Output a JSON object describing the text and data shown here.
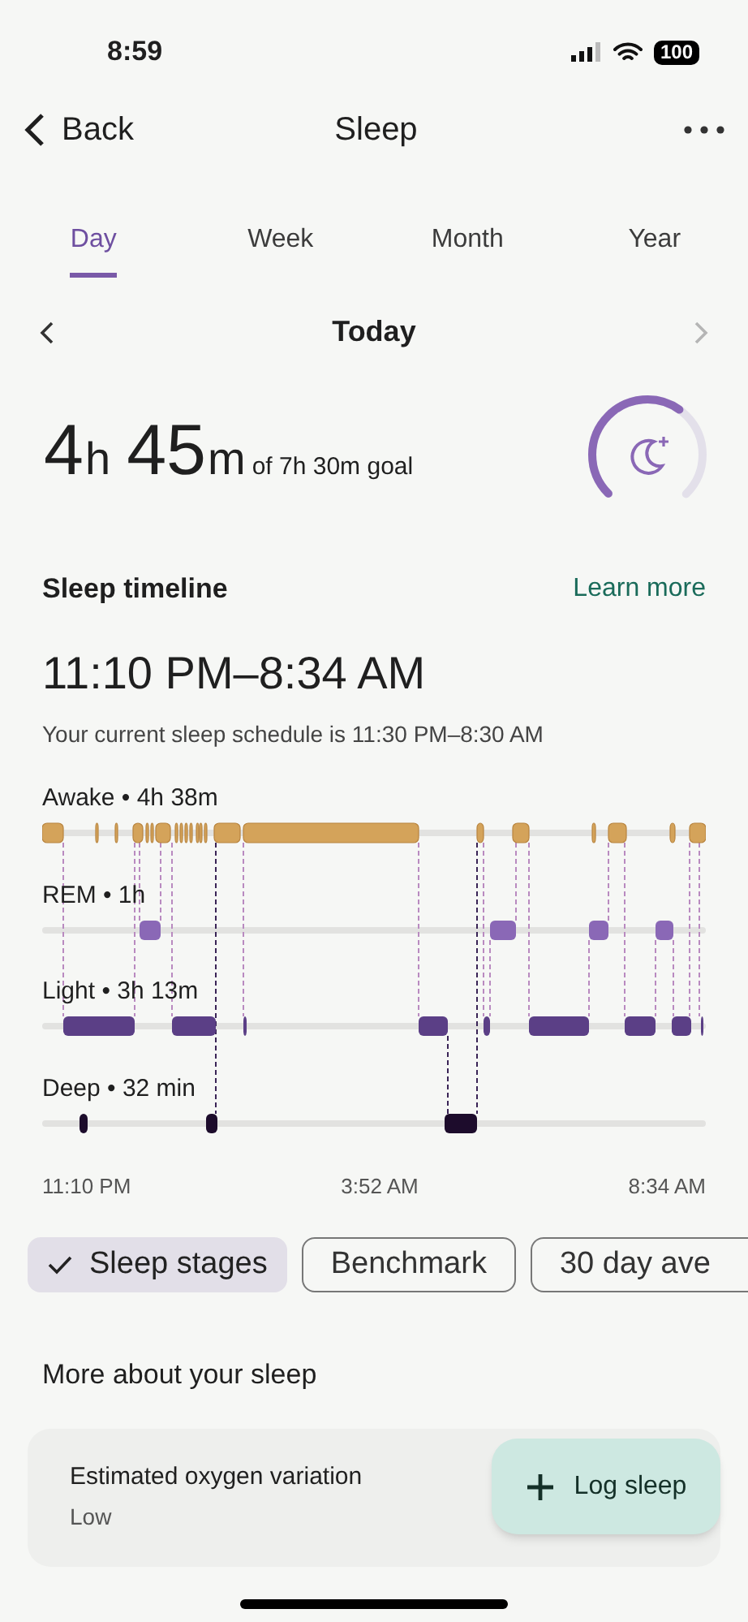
{
  "status_bar": {
    "time": "8:59",
    "battery": "100"
  },
  "header": {
    "back": "Back",
    "title": "Sleep"
  },
  "tabs": [
    {
      "label": "Day",
      "selected": true
    },
    {
      "label": "Week",
      "selected": false
    },
    {
      "label": "Month",
      "selected": false
    },
    {
      "label": "Year",
      "selected": false
    }
  ],
  "date_nav": {
    "title": "Today",
    "next_disabled": true
  },
  "summary": {
    "hours": "4",
    "hours_unit": "h",
    "minutes": "45",
    "minutes_unit": "m",
    "goal": "of 7h 30m goal"
  },
  "timeline": {
    "title": "Sleep timeline",
    "link": "Learn more",
    "range": "11:10 PM–8:34 AM",
    "schedule": "Your current sleep schedule is 11:30 PM–8:30 AM",
    "stages": [
      {
        "label": "Awake • 4h 38m"
      },
      {
        "label": "REM • 1h"
      },
      {
        "label": "Light • 3h 13m"
      },
      {
        "label": "Deep • 32 min"
      }
    ],
    "axis": [
      "11:10 PM",
      "3:52 AM",
      "8:34 AM"
    ]
  },
  "chips": [
    {
      "label": "Sleep stages",
      "selected": true
    },
    {
      "label": "Benchmark",
      "selected": false
    },
    {
      "label": "30 day ave",
      "selected": false
    }
  ],
  "more": {
    "title": "More about your sleep",
    "card": {
      "title": "Estimated oxygen variation",
      "value": "Low"
    }
  },
  "fab": {
    "label": "Log sleep"
  }
}
